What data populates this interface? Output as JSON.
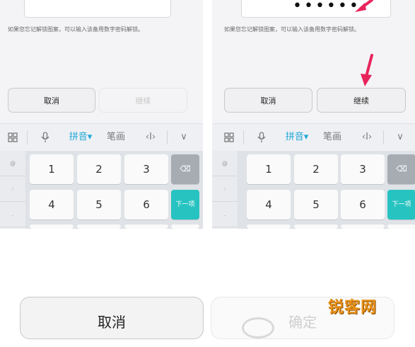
{
  "left_panel": {
    "hint": "如果您忘记解锁图案，可以输入该备用数字密码解锁。",
    "cancel_label": "取消",
    "continue_label": "继续"
  },
  "right_panel": {
    "password_dots": "••••••",
    "hint": "如果您忘记解锁图案，可以输入该备用数字密码解锁。",
    "cancel_label": "取消",
    "continue_label": "继续"
  },
  "ime_bar": {
    "pinyin": "拼音▾",
    "stroke": "笔画",
    "cursor": "‹I›",
    "collapse": "∨"
  },
  "keyboard": {
    "side_keys": [
      "@",
      ":",
      "."
    ],
    "rows": [
      [
        "1",
        "2",
        "3"
      ],
      [
        "4",
        "5",
        "6"
      ]
    ],
    "next_label": "下一项"
  },
  "bottom": {
    "cancel_label": "取消",
    "confirm_label": "确定"
  },
  "watermark": "锐客网",
  "colors": {
    "accent": "#27c3c1",
    "pinyin_blue": "#22a7d7",
    "arrow": "#e8245c"
  }
}
